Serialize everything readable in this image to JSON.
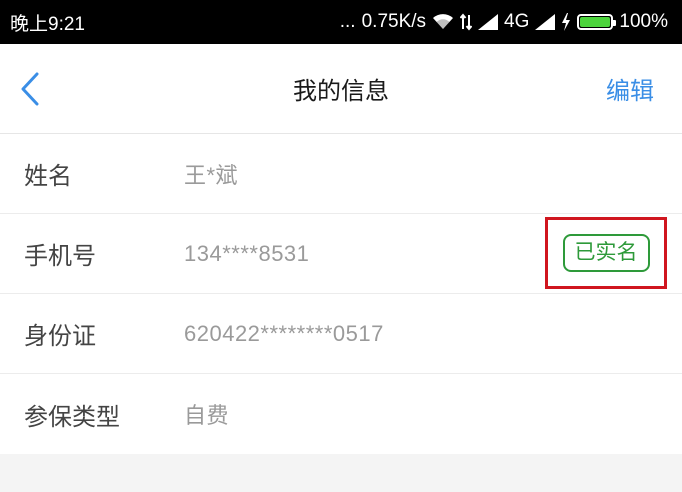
{
  "status_bar": {
    "time": "晚上9:21",
    "dots": "...",
    "speed": "0.75K/s",
    "network": "4G",
    "battery_percent": "100%",
    "battery_level": 1.0,
    "icons": [
      "wifi-icon",
      "data-transfer-icon",
      "signal-icon",
      "signal-icon",
      "charging-icon",
      "battery-icon"
    ]
  },
  "nav": {
    "back_icon": "chevron-left-icon",
    "title": "我的信息",
    "edit_label": "编辑",
    "accent_color": "#3a8ee6"
  },
  "info": {
    "rows": [
      {
        "label": "姓名",
        "value": "王*斌"
      },
      {
        "label": "手机号",
        "value": "134****8531",
        "badge": "已实名"
      },
      {
        "label": "身份证",
        "value": "620422********0517"
      },
      {
        "label": "参保类型",
        "value": "自费"
      }
    ],
    "badge_color": "#2e9a3a",
    "highlight_color": "#d0161f"
  }
}
